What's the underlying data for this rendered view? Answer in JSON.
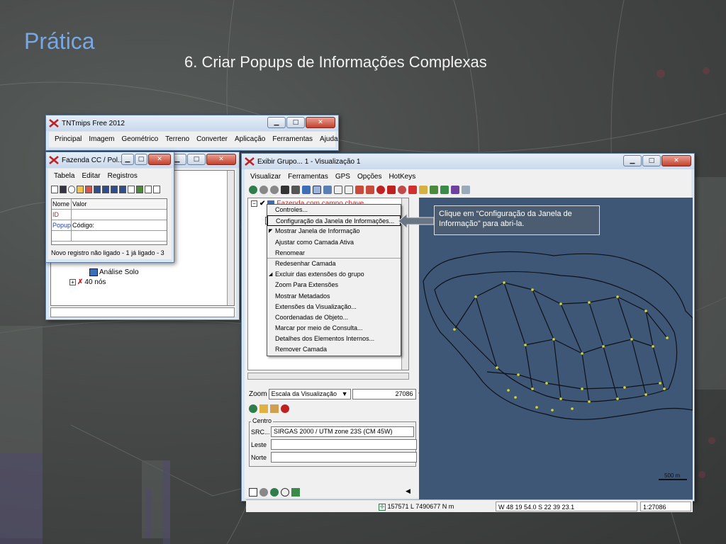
{
  "slide": {
    "title": "Prática",
    "subtitle": "6. Criar Popups de Informações Complexas"
  },
  "tnt_window": {
    "title": "TNTmips Free 2012",
    "menu": [
      "Principal",
      "Imagem",
      "Geométrico",
      "Terreno",
      "Converter",
      "Aplicação",
      "Ferramentas",
      "Ajuda"
    ]
  },
  "layer_window": {
    "rows": [
      "Análise Solo",
      "40 nós"
    ]
  },
  "table_window": {
    "title": "Fazenda CC / Pol...",
    "menu": [
      "Tabela",
      "Editar",
      "Registros"
    ],
    "columns": [
      "Nome",
      "Valor"
    ],
    "rows": [
      {
        "name": "ID",
        "value": ""
      },
      {
        "name": "Popup",
        "value": "Código:"
      }
    ],
    "status": "Novo registro não ligado - 1 já ligado - 3"
  },
  "viz_window": {
    "title": "Exibir Grupo... 1 - Visualização 1",
    "menu": [
      "Visualizar",
      "Ferramentas",
      "GPS",
      "Opções",
      "HotKeys"
    ],
    "tree_layer": "Fazenda com campo chave",
    "zoom_label": "Zoom",
    "zoom_mode": "Escala da Visualização",
    "zoom_value": "27086",
    "centro_label": "Centro",
    "src_label": "SRC...",
    "src_value": "SIRGAS 2000 / UTM zone 23S (CM 45W)",
    "leste_label": "Leste",
    "norte_label": "Norte",
    "scale_bar": "500 m",
    "status": {
      "coords": "157571 L  7490677 N m",
      "latlon": "W 48 19 54.0  S 22 39 23.1",
      "scale": "1:27086"
    }
  },
  "context_menu": {
    "items": [
      {
        "label": "Controles...",
        "mark": "",
        "boxed": false
      },
      {
        "label": "Configuração da Janela de Informações...",
        "mark": "",
        "boxed": true
      },
      {
        "label": "Mostrar Janela de Informação",
        "mark": "check",
        "boxed": false
      },
      {
        "label": "Ajustar como Camada Ativa",
        "mark": "",
        "boxed": false
      },
      {
        "label": "Renomear",
        "mark": "",
        "boxed": false
      },
      {
        "label": "Redesenhar Camada",
        "mark": "",
        "boxed": false
      },
      {
        "label": "Excluir das extensões do grupo",
        "mark": "triangle",
        "boxed": false
      },
      {
        "label": "Zoom Para Extensões",
        "mark": "",
        "boxed": false
      },
      {
        "label": "Mostrar Metadados",
        "mark": "",
        "boxed": false
      },
      {
        "label": "Extensões da Visualização...",
        "mark": "",
        "boxed": false
      },
      {
        "label": "Coordenadas de Objeto...",
        "mark": "",
        "boxed": false
      },
      {
        "label": "Marcar por meio de Consulta...",
        "mark": "",
        "boxed": false
      },
      {
        "label": "Detalhes dos Elementos Internos...",
        "mark": "",
        "boxed": false
      },
      {
        "label": "Remover Camada",
        "mark": "",
        "boxed": false
      }
    ]
  },
  "callout": {
    "text": "Clique em “Configuração da Janela de Informação” para abri-la."
  },
  "colors": {
    "title_blue": "#79a7e3",
    "map_bg": "#3e5777",
    "callout_bg": "#4d5d71",
    "close_red": "#c4412d"
  }
}
